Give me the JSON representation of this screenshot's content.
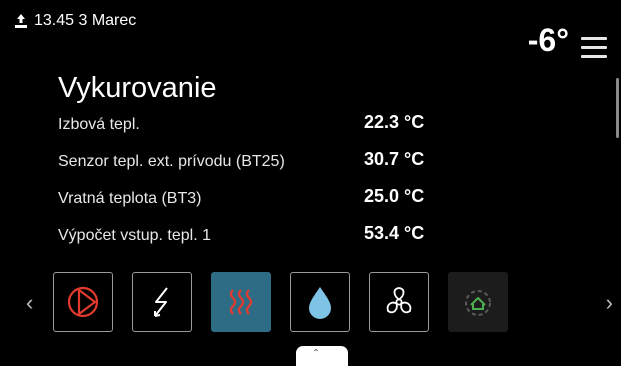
{
  "status_bar": {
    "time_date": "13.45 3 Marec",
    "upload_icon": "upload-icon"
  },
  "header": {
    "outdoor_temperature": "-6°",
    "menu_icon": "menu-icon"
  },
  "page": {
    "title": "Vykurovanie",
    "rows": [
      {
        "label": "Izbová tepl.",
        "value": "22.3 °C"
      },
      {
        "label": "Senzor tepl. ext. prívodu (BT25)",
        "value": "30.7 °C"
      },
      {
        "label": "Vratná teplota (BT3)",
        "value": "25.0 °C"
      },
      {
        "label": "Výpočet vstup. tepl. 1",
        "value": "53.4 °C"
      }
    ]
  },
  "icon_bar": {
    "left_arrow": "‹",
    "right_arrow": "›",
    "tiles": [
      {
        "icon": "compressor-icon",
        "state": "normal",
        "color": "#e23b2e"
      },
      {
        "icon": "electric-heater-icon",
        "state": "normal",
        "color": "#ffffff"
      },
      {
        "icon": "heating-icon",
        "state": "active",
        "color": "#e23b2e"
      },
      {
        "icon": "hot-water-drop-icon",
        "state": "normal",
        "color": "#7fc4e6"
      },
      {
        "icon": "ventilation-fan-icon",
        "state": "normal",
        "color": "#ffffff"
      },
      {
        "icon": "smart-home-icon",
        "state": "disabled",
        "color": "#4caf50"
      }
    ],
    "active_color": "#2e6b84"
  },
  "bottom_tab": {
    "chevron": "ˆ"
  }
}
